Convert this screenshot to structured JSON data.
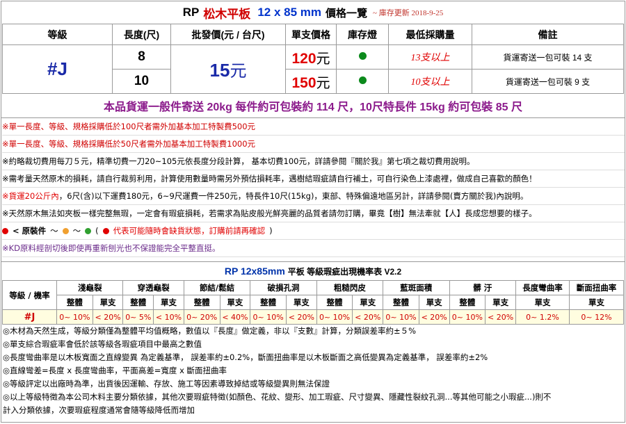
{
  "header": {
    "code": "RP",
    "name": "松木平板",
    "spec": "12 x 85 mm",
    "suffix": "價格一覽",
    "update": "~ 庫存更新 2018-9-25"
  },
  "price_table": {
    "headers": [
      "等級",
      "長度(尺)",
      "批發價(元 / 台尺)",
      "單支價格",
      "庫存燈",
      "最低採購量",
      "備註"
    ],
    "grade": "#J",
    "wholesale_value": "15",
    "wholesale_unit": "元",
    "rows": [
      {
        "length": "8",
        "price": "120",
        "price_unit": "元",
        "stock": "green",
        "min": "13支以上",
        "note": "貨運寄送一包可裝 14 支"
      },
      {
        "length": "10",
        "price": "150",
        "price_unit": "元",
        "stock": "green",
        "min": "10支以上",
        "note": "貨運寄送一包可裝 9 支"
      }
    ]
  },
  "shipping_note": "本品貨運一般件寄送 20kg 每件約可包裝約 114 尺，10尺特長件 15kg 約可包裝 85 尺",
  "rules": [
    "※單一長度、等級、規格採購低於100尺者需外加基本加工特製費500元",
    "※單一長度、等級、規格採購低於50尺者需外加基本加工特製費1000元",
    "※約略裁切費用每刀５元，精準切費一刀20~105元依長度分段計算， 基本切費100元，詳請參閱『關於我』第七項之裁切費用說明。",
    "※需考量天然原木的損耗，請自行裁剪利用，計算使用數量時需另外預估損耗率，遇樹結瑕疵請自行補土，可自行染色上漆處裡，做成自己喜歡的顏色！",
    "貨運20公斤內",
    "，6尺(含)以下運費180元，6~9尺運費一件250元，特長件10尺(15kg)，東部、特殊偏遠地區另計，詳請參閱(賣方關於我)內說明。",
    "※天然原木無法如夾板一樣完整無瑕，一定會有瑕疵損耗，若需求為貼皮般光鮮亮麗的品質者請勿訂購，畢竟【樹】無法牽就【人】長成您想要的樣子。",
    "※KD原料經剖切後即使再重新刨光也不保證能完全平整直挺。"
  ],
  "legend": {
    "prefix": "< 原裝件",
    "sep": "～",
    "paren_open": "(",
    "text": "代表可能隨時會缺貨狀態，訂購前請再確認",
    "paren_close": ")",
    "colors": [
      "#e00000",
      "#f0a030",
      "#30a030"
    ]
  },
  "defect": {
    "title": "RP  12x85mm",
    "title_suffix": "平板 等級瑕疵出現機率表 V2.2",
    "col0": "等級 / 機率",
    "categories": [
      "淺龜裂",
      "穿透龜裂",
      "節結/鬆結",
      "破損孔洞",
      "粗糙閃皮",
      "藍斑面積",
      "髒  汙",
      "長度彎曲率",
      "斷面扭曲率"
    ],
    "sub": [
      "整體",
      "單支"
    ],
    "grade": "#J",
    "values": [
      "0~ 10%",
      "< 20%",
      "0~ 5%",
      "< 10%",
      "0~ 20%",
      "< 40%",
      "0~ 10%",
      "< 20%",
      "0~ 10%",
      "< 20%",
      "0~ 10%",
      "< 20%",
      "0~ 10%",
      "< 20%",
      "0~ 1.2%",
      "0~ 12%"
    ]
  },
  "footnotes": [
    "◎木材為天然生成，等級分類僅為整體平均值概略，數值以『長度』做定義，非以『支數』計算，分類誤差率約±５%",
    "◎單支綜合瑕疵率會低於該等級各瑕疵項目中最高之數值",
    "◎長度彎曲率是以木板寬面之直線變異 為定義基準， 誤差率約±0.2%，斷面扭曲率是以木板斷面之高低變異為定義基準， 誤差率約±2%",
    "◎直線彎差=長度 x 長度彎曲率，平面高差=寬度 x 斷面扭曲率",
    "◎等級評定以出廠時為準，出貨後因運輸、存放、施工等因素導致掉結或等級變異則無法保證",
    "◎以上等級特徵為本公司木料主要分類依據，其他次要瑕疵特徵(如顏色、花紋、變形、加工瑕疵、尺寸變異、隱藏性裂紋孔洞...等其他可能之小瑕疵...)則不",
    "計入分類依據，次要瑕疵程度通常會隨等級降低而增加"
  ]
}
